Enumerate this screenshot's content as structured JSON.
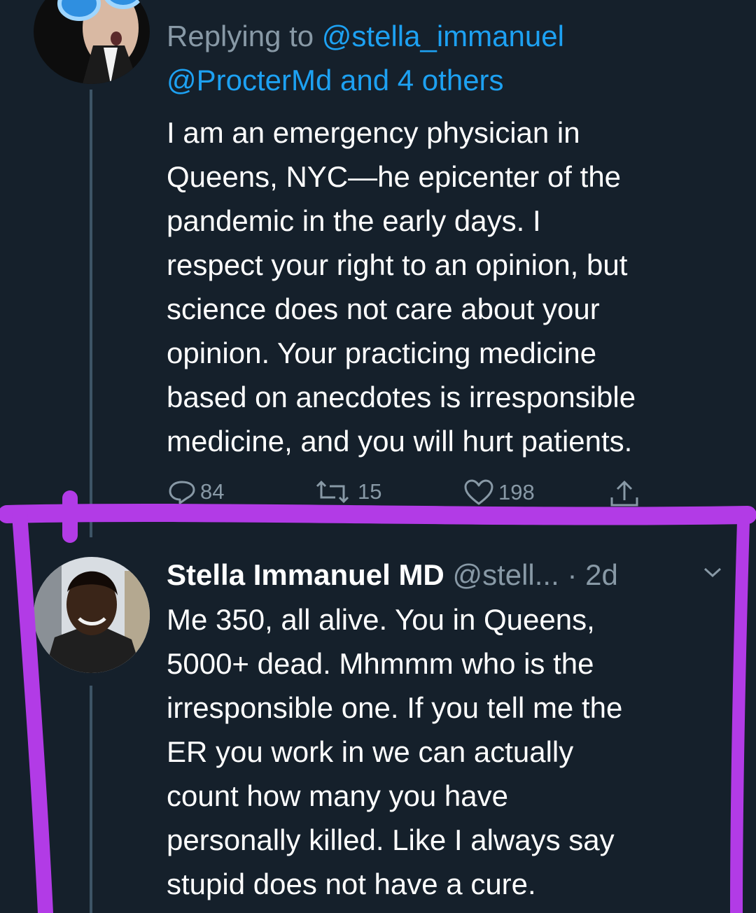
{
  "first_tweet": {
    "reply_prefix": "Replying to ",
    "reply_handle_1": "@stella_immanuel",
    "reply_handle_2": "@ProcterMd",
    "reply_connector": " and ",
    "reply_others": "4 others",
    "text": "I am an emergency physician in\nQueens, NYC—he epicenter of the\npandemic in the early days. I\nrespect your right to an opinion, but\nscience does not care about your\nopinion.  Your practicing medicine\nbased on anecdotes is irresponsible\nmedicine, and you will hurt patients.",
    "actions": {
      "reply_count": "84",
      "retweet_count": "15",
      "like_count": "198"
    }
  },
  "second_tweet": {
    "author_name": "Stella Immanuel MD",
    "handle": "@stell...",
    "separator": " · ",
    "time": "2d",
    "text": "Me 350, all alive. You in Queens,\n5000+ dead. Mhmmm who is the\nirresponsible one. If you tell me the\nER you work in we can actually\ncount how many you have\npersonally killed. Like I always say\nstupid does not have a cure."
  },
  "colors": {
    "background": "#15202b",
    "text": "#ffffff",
    "secondary": "#8899a6",
    "link": "#1da1f2",
    "highlight": "#b23be6"
  },
  "icons": [
    "reply-icon",
    "retweet-icon",
    "like-icon",
    "share-icon",
    "chevron-down-icon"
  ]
}
